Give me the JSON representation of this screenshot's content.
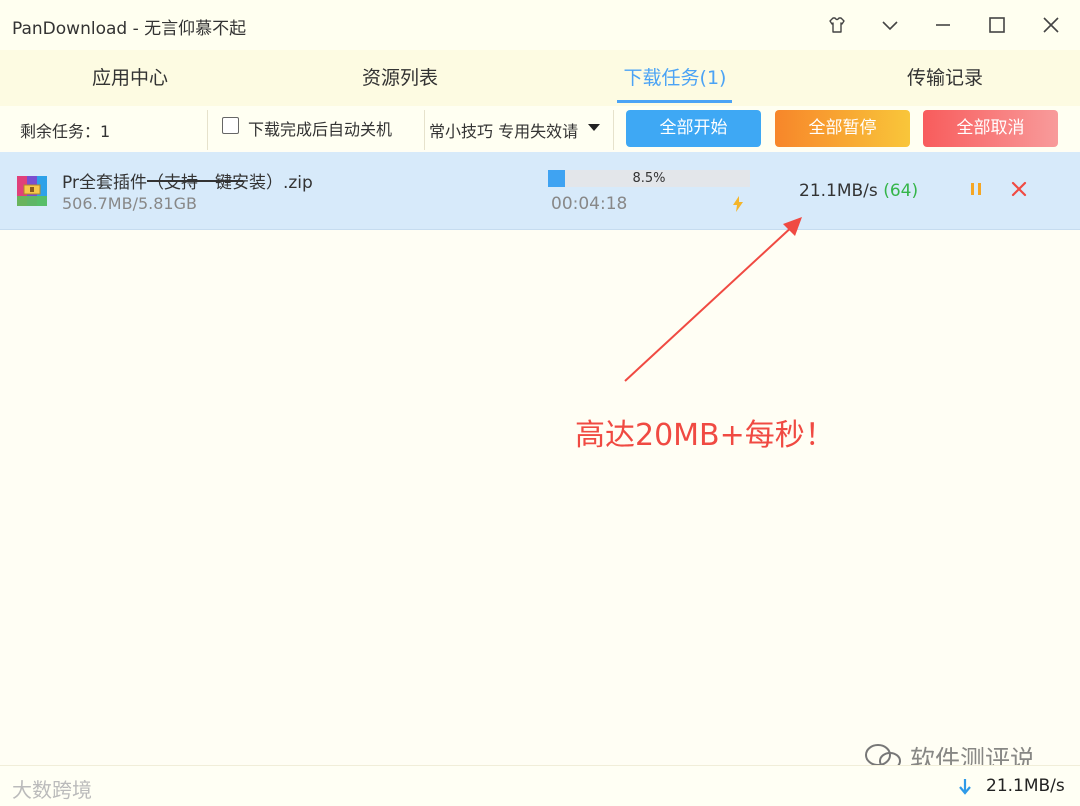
{
  "window": {
    "title": "PanDownload - 无言仰慕不起"
  },
  "tabs": [
    {
      "label": "应用中心",
      "active": false
    },
    {
      "label": "资源列表",
      "active": false
    },
    {
      "label": "下载任务(1)",
      "active": true
    },
    {
      "label": "传输记录",
      "active": false
    }
  ],
  "toolbar": {
    "remaining": "剩余任务：1",
    "auto_shutdown_label": "下载完成后自动关机",
    "auto_shutdown_checked": false,
    "tip_marquee": "常小技巧 专用失效请",
    "start_all": "全部开始",
    "pause_all": "全部暂停",
    "cancel_all": "全部取消"
  },
  "task": {
    "filename": "Pr全套插件（支持一键安装）.zip",
    "size": "506.7MB/5.81GB",
    "progress_percent": 8.5,
    "progress_text": "8.5%",
    "elapsed": "00:04:18",
    "speed": "21.1MB/s",
    "connections": "(64)"
  },
  "annotation": {
    "text": "高达20MB+每秒！"
  },
  "watermark": {
    "text": "软件测评说",
    "logo_text": "大数跨境"
  },
  "status": {
    "speed": "21.1MB/s"
  },
  "colors": {
    "accent": "#4ba3f5",
    "start_btn": "#3ea8f4",
    "pause_btn": "#f7862a",
    "cancel_btn": "#f85c5c",
    "annotation": "#f04a42",
    "connection_green": "#35b549"
  }
}
